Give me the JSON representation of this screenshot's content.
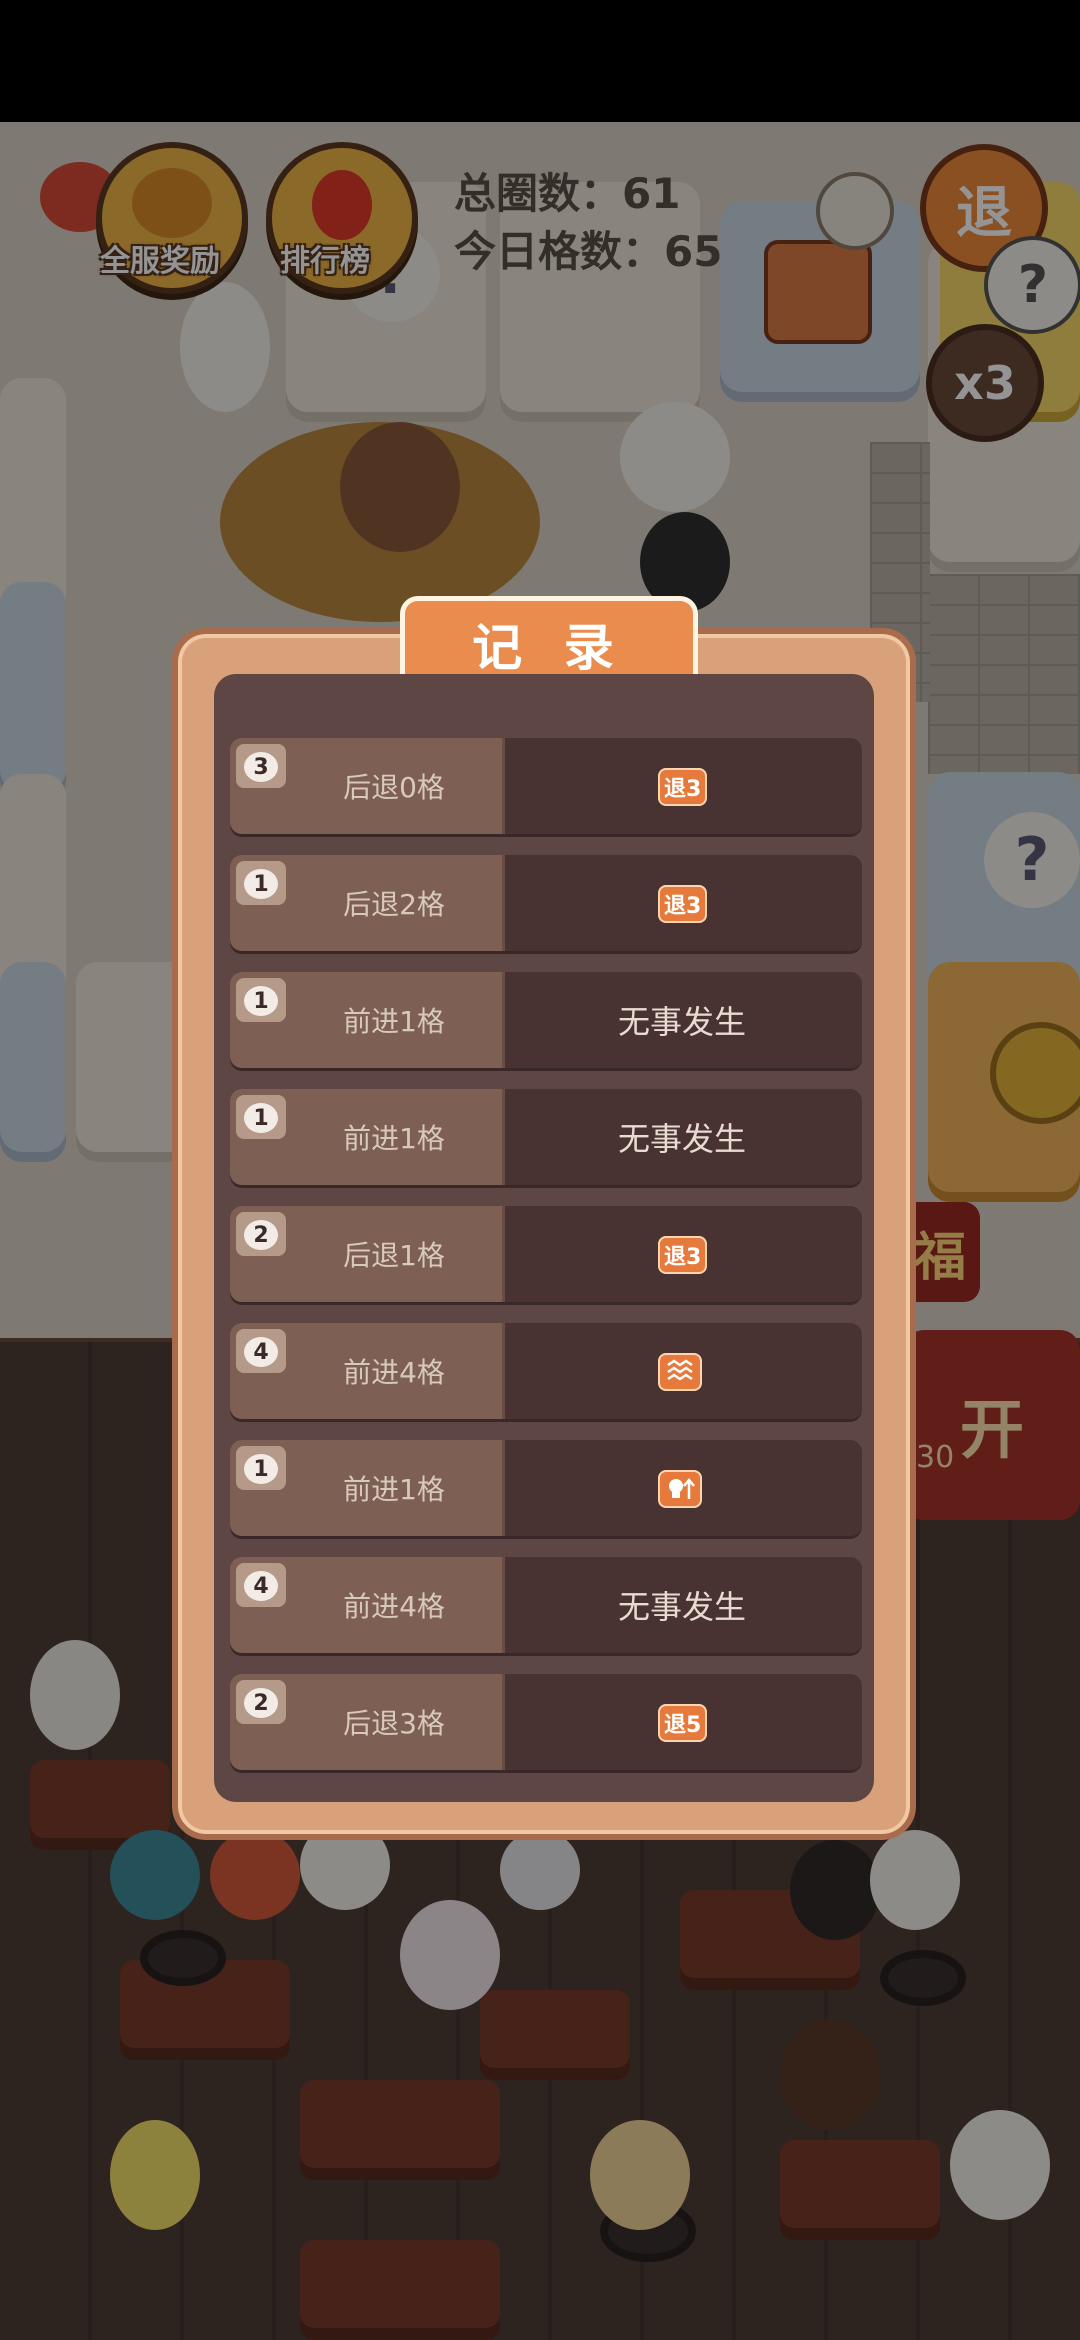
{
  "hud": {
    "all_server_reward_label": "全服奖励",
    "leaderboard_label": "排行榜",
    "total_laps_label": "总圈数：",
    "total_laps_value": "61",
    "today_steps_label": "今日格数：",
    "today_steps_value": "65",
    "retreat_button_label": "退",
    "multiplier_label": "x3",
    "question_mark": "?"
  },
  "board_bits": {
    "fu_char": "福",
    "shop_char": "开",
    "shop_sub": "30"
  },
  "modal": {
    "title": "记 录",
    "records": [
      {
        "dice": "3",
        "move": "后退0格",
        "result_type": "badge",
        "badge": "退3",
        "result": ""
      },
      {
        "dice": "1",
        "move": "后退2格",
        "result_type": "badge",
        "badge": "退3",
        "result": ""
      },
      {
        "dice": "1",
        "move": "前进1格",
        "result_type": "text",
        "badge": "",
        "result": "无事发生"
      },
      {
        "dice": "1",
        "move": "前进1格",
        "result_type": "text",
        "badge": "",
        "result": "无事发生"
      },
      {
        "dice": "2",
        "move": "后退1格",
        "result_type": "badge",
        "badge": "退3",
        "result": ""
      },
      {
        "dice": "4",
        "move": "前进4格",
        "result_type": "icon",
        "badge": "",
        "icon": "wave-icon",
        "result": ""
      },
      {
        "dice": "1",
        "move": "前进1格",
        "result_type": "icon",
        "badge": "",
        "icon": "skull-up-icon",
        "result": ""
      },
      {
        "dice": "4",
        "move": "前进4格",
        "result_type": "text",
        "badge": "",
        "result": "无事发生"
      },
      {
        "dice": "2",
        "move": "后退3格",
        "result_type": "badge",
        "badge": "退5",
        "result": ""
      }
    ]
  },
  "colors": {
    "modal_frame": "#d9a17a",
    "modal_inner": "#5e4645",
    "title_bg": "#e98c4e",
    "badge_bg": "#e67a3c"
  }
}
